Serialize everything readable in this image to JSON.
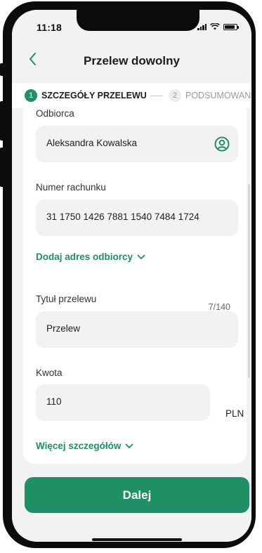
{
  "status_bar": {
    "time": "11:18"
  },
  "header": {
    "title": "Przelew dowolny",
    "back_icon": "chevron-left-icon"
  },
  "steps": [
    {
      "number": "1",
      "label": "SZCZEGÓŁY PRZELEWU",
      "active": true
    },
    {
      "number": "2",
      "label": "PODSUMOWANIE",
      "active": false
    }
  ],
  "form": {
    "recipient": {
      "label": "Odbiorca",
      "value": "Aleksandra Kowalska",
      "icon": "contact-person-icon"
    },
    "account": {
      "label": "Numer rachunku",
      "value": "31 1750 1426 7881 1540 7484 1724"
    },
    "add_address_link": "Dodaj adres odbiorcy",
    "transfer_title": {
      "label": "Tytuł przelewu",
      "value": "Przelew",
      "counter": "7/140"
    },
    "amount": {
      "label": "Kwota",
      "value": "110",
      "currency": "PLN"
    },
    "more_details_link": "Więcej szczegółów"
  },
  "next_button": "Dalej",
  "colors": {
    "accent": "#1f8f66",
    "field_bg": "#f2f2f2",
    "screen_bg": "#f1f2f3"
  }
}
